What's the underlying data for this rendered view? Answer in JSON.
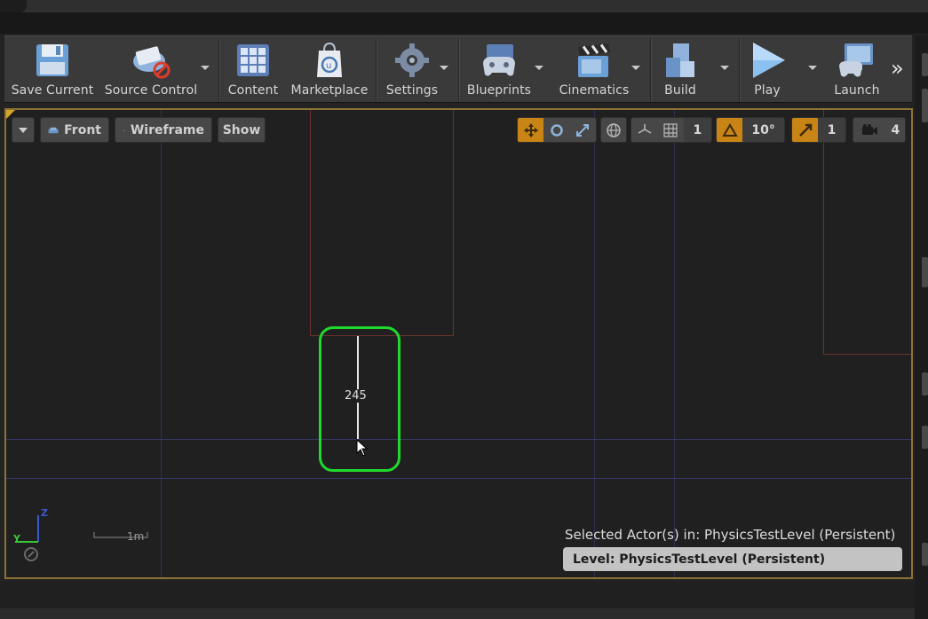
{
  "toolbar": {
    "items": [
      {
        "label": "Save Current",
        "icon": "save-floppy-icon",
        "has_dropdown": false
      },
      {
        "label": "Source Control",
        "icon": "source-control-icon",
        "has_dropdown": true
      },
      {
        "label": "Content",
        "icon": "content-grid-icon",
        "has_dropdown": false
      },
      {
        "label": "Marketplace",
        "icon": "marketplace-bag-icon",
        "has_dropdown": false
      },
      {
        "label": "Settings",
        "icon": "settings-gear-icon",
        "has_dropdown": true
      },
      {
        "label": "Blueprints",
        "icon": "blueprints-gamepad-icon",
        "has_dropdown": true
      },
      {
        "label": "Cinematics",
        "icon": "cinematics-clapper-icon",
        "has_dropdown": true
      },
      {
        "label": "Build",
        "icon": "build-blocks-icon",
        "has_dropdown": true
      },
      {
        "label": "Play",
        "icon": "play-triangle-icon",
        "has_dropdown": true
      },
      {
        "label": "Launch",
        "icon": "launch-monitor-icon",
        "has_dropdown": false
      }
    ],
    "more_glyph": "»"
  },
  "viewport": {
    "view_label": "Front",
    "mode_label": "Wireframe",
    "show_label": "Show",
    "grid_snap_value": "1",
    "rotation_snap_value": "10°",
    "scale_snap_value": "1",
    "camera_speed_value": "4",
    "measure_value": "245",
    "axis_y": "Y",
    "axis_z": "Z",
    "scale_label": "1m",
    "selected_actors_text": "Selected Actor(s) in:  PhysicsTestLevel (Persistent)",
    "level_label": "Level:  PhysicsTestLevel (Persistent)"
  },
  "colors": {
    "accent_orange": "#c88414",
    "highlight_green": "#1fd92c",
    "viewport_border": "#8d7334"
  }
}
